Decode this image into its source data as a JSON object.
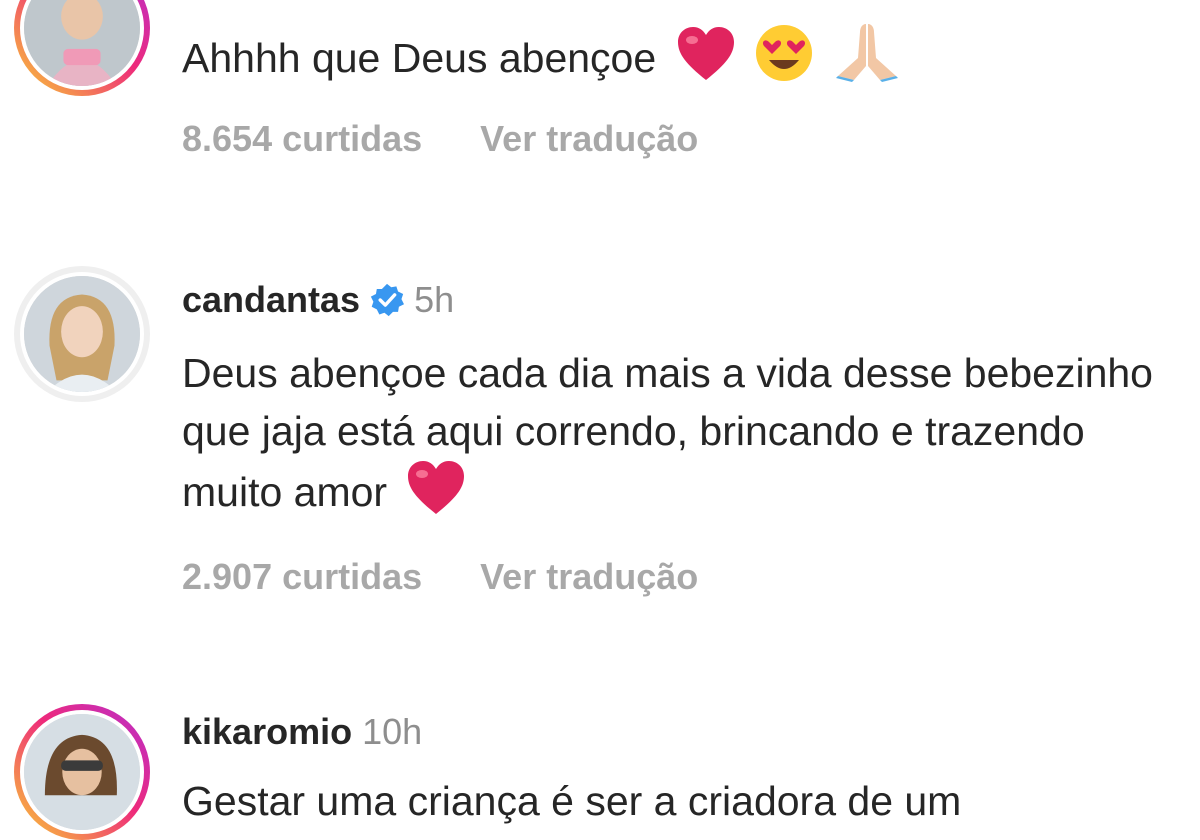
{
  "comments": [
    {
      "text": "Ahhhh que Deus abençoe",
      "emojis": [
        "red-heart-icon",
        "heart-eyes-icon",
        "folded-hands-icon"
      ],
      "likes": "8.654 curtidas",
      "translate": "Ver tradução"
    },
    {
      "username": "candantas",
      "verified": true,
      "time": "5h",
      "text": "Deus abençoe cada dia mais a vida desse bebezinho que jaja está aqui correndo, brincando e trazendo muito amor",
      "emojis": [
        "red-heart-icon"
      ],
      "likes": "2.907 curtidas",
      "translate": "Ver tradução"
    },
    {
      "username": "kikaromio",
      "time": "10h",
      "text": "Gestar uma criança é ser a criadora de um"
    }
  ],
  "colors": {
    "text": "#262626",
    "muted": "#8e8e8e",
    "meta": "#a8a8a8",
    "verified": "#3897f0",
    "heart": "#e0245e"
  }
}
